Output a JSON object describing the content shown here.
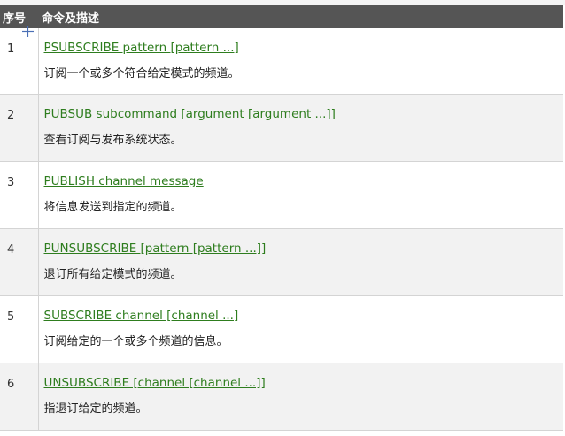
{
  "table": {
    "headers": {
      "num": "序号",
      "desc": "命令及描述"
    },
    "rows": [
      {
        "num": "1",
        "command": "PSUBSCRIBE pattern [pattern ...]",
        "description": "订阅一个或多个符合给定模式的频道。"
      },
      {
        "num": "2",
        "command": "PUBSUB subcommand [argument [argument ...]]",
        "description": "查看订阅与发布系统状态。"
      },
      {
        "num": "3",
        "command": "PUBLISH channel message",
        "description": "将信息发送到指定的频道。"
      },
      {
        "num": "4",
        "command": "PUNSUBSCRIBE [pattern [pattern ...]]",
        "description": "退订所有给定模式的频道。"
      },
      {
        "num": "5",
        "command": "SUBSCRIBE channel [channel ...]",
        "description": "订阅给定的一个或多个频道的信息。"
      },
      {
        "num": "6",
        "command": "UNSUBSCRIBE [channel [channel ...]]",
        "description": "指退订给定的频道。"
      }
    ]
  },
  "icons": {
    "cursor": "crosshair-cursor-icon"
  },
  "colors": {
    "header_bg": "#555555",
    "header_text": "#ffffff",
    "link": "#2e7d1e",
    "alt_row_bg": "#f2f2f2",
    "border": "#d4d4d4"
  }
}
